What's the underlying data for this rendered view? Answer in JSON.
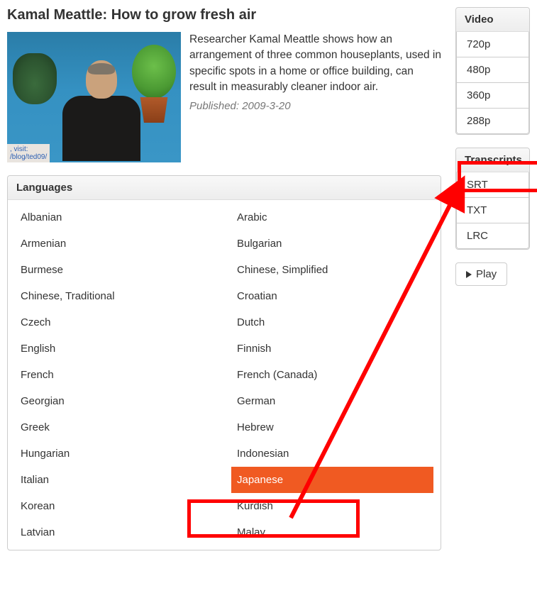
{
  "title": "Kamal Meattle: How to grow fresh air",
  "description": "Researcher Kamal Meattle shows how an arrangement of three common houseplants, used in specific spots in a home or office building, can result in measurably cleaner indoor air.",
  "published_label": "Published: 2009-3-20",
  "thumb_caption_top": ", visit:",
  "thumb_caption_bottom": "/blog/ted09/",
  "panels": {
    "languages_title": "Languages",
    "video_title": "Video",
    "transcripts_title": "Transcripts"
  },
  "languages_col1": [
    "Albanian",
    "Armenian",
    "Burmese",
    "Chinese, Traditional",
    "Czech",
    "English",
    "French",
    "Georgian",
    "Greek",
    "Hungarian",
    "Italian",
    "Korean",
    "Latvian"
  ],
  "languages_col2": [
    "Arabic",
    "Bulgarian",
    "Chinese, Simplified",
    "Croatian",
    "Dutch",
    "Finnish",
    "French (Canada)",
    "German",
    "Hebrew",
    "Indonesian",
    "Japanese",
    "Kurdish",
    "Malay"
  ],
  "selected_language": "Japanese",
  "video_options": [
    "720p",
    "480p",
    "360p",
    "288p"
  ],
  "transcript_options": [
    "SRT",
    "TXT",
    "LRC"
  ],
  "play_label": "Play"
}
